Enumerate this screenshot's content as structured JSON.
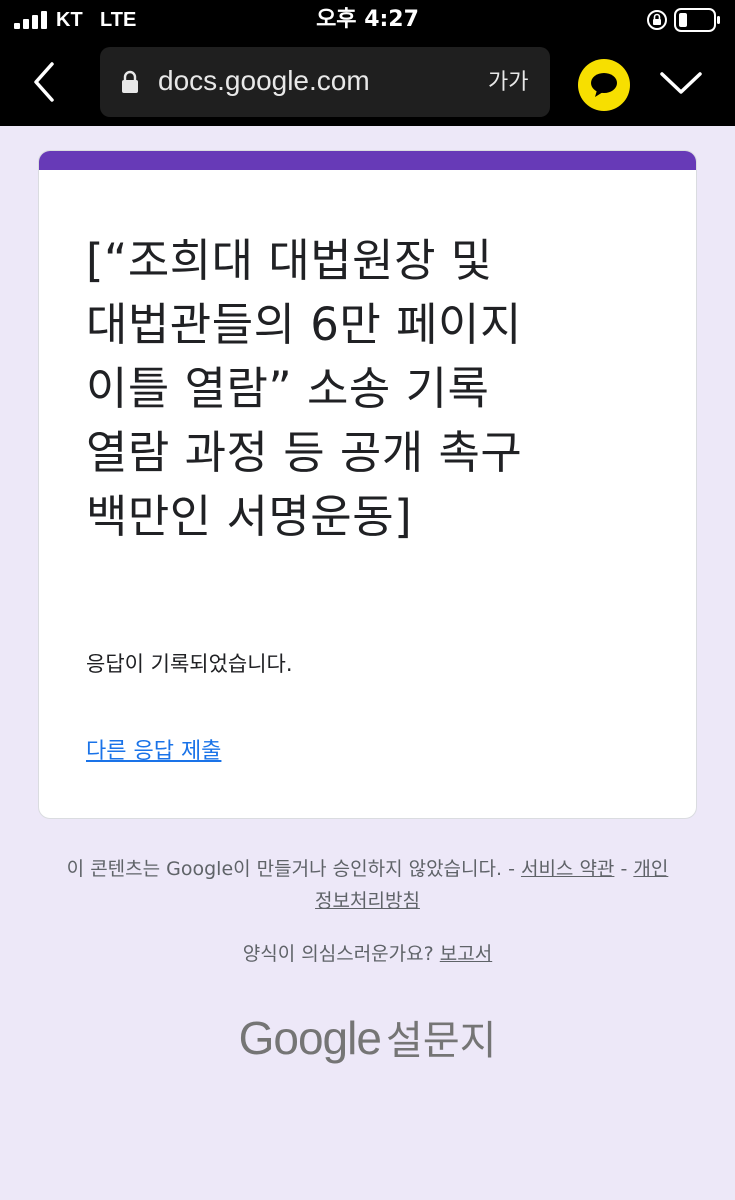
{
  "status_bar": {
    "carrier": "KT",
    "network": "LTE",
    "time": "오후 4:27"
  },
  "browser": {
    "url": "docs.google.com",
    "text_size_label": "가가",
    "icons": {
      "back": "chevron-left-icon",
      "lock": "lock-icon",
      "talk": "kakaotalk-icon",
      "collapse": "chevron-down-icon"
    }
  },
  "form": {
    "accent_color": "#673ab7",
    "title_lines": [
      "[“조희대 대법원장 및",
      "대법관들의 6만 페이지",
      "이틀 열람” 소송 기록",
      "열람 과정 등 공개 촉구",
      "백만인 서명운동]"
    ],
    "confirmation": "응답이 기록되었습니다.",
    "another_response_link": "다른 응답 제출"
  },
  "footer": {
    "disclaimer": "이 콘텐츠는 Google이 만들거나 승인하지 않았습니다. - ",
    "terms_link": "서비스 약관",
    "separator": " - ",
    "privacy_link": "개인정보처리방침",
    "report_question": "양식이 의심스러운가요? ",
    "report_link": "보고서",
    "brand_google": "Google",
    "brand_product": "설문지"
  },
  "colors": {
    "page_background": "#ede8f8",
    "link": "#1a73e8",
    "talk_button": "#f7df00"
  }
}
